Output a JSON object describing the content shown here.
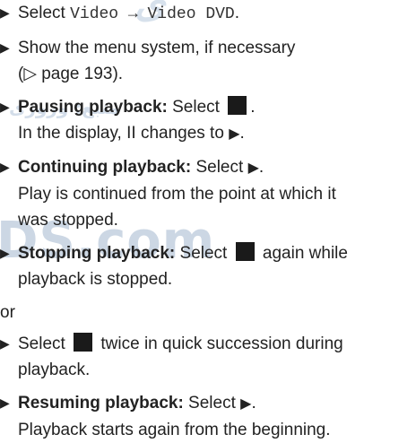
{
  "watermark": {
    "top_text": "ی",
    "rtl_text": "منبع: وروزی",
    "mid_text": "DS.com"
  },
  "steps": [
    {
      "lines": [
        {
          "parts": [
            {
              "t": "text",
              "v": "Select "
            },
            {
              "t": "mono",
              "v": "Video → Video DVD"
            },
            {
              "t": "text",
              "v": "."
            }
          ]
        }
      ]
    },
    {
      "lines": [
        {
          "parts": [
            {
              "t": "text",
              "v": "Show the menu system, if necessary"
            }
          ]
        },
        {
          "parts": [
            {
              "t": "text",
              "v": "(▷ page 193)."
            }
          ]
        }
      ]
    },
    {
      "lines": [
        {
          "parts": [
            {
              "t": "bold",
              "v": "Pausing playback:"
            },
            {
              "t": "text",
              "v": " Select "
            },
            {
              "t": "stop"
            },
            {
              "t": "text",
              "v": "."
            }
          ]
        },
        {
          "parts": [
            {
              "t": "text",
              "v": "In the display, II changes to "
            },
            {
              "t": "play"
            },
            {
              "t": "text",
              "v": "."
            }
          ]
        }
      ]
    },
    {
      "lines": [
        {
          "parts": [
            {
              "t": "bold",
              "v": "Continuing playback:"
            },
            {
              "t": "text",
              "v": " Select "
            },
            {
              "t": "play"
            },
            {
              "t": "text",
              "v": "."
            }
          ]
        },
        {
          "parts": [
            {
              "t": "text",
              "v": "Play is continued from the point at which it"
            }
          ]
        },
        {
          "parts": [
            {
              "t": "text",
              "v": "was stopped."
            }
          ]
        }
      ]
    },
    {
      "lines": [
        {
          "parts": [
            {
              "t": "bold",
              "v": "Stopping playback:"
            },
            {
              "t": "text",
              "v": " Select "
            },
            {
              "t": "stop"
            },
            {
              "t": "text",
              "v": " again while"
            }
          ]
        },
        {
          "parts": [
            {
              "t": "text",
              "v": "playback is stopped."
            }
          ]
        }
      ]
    }
  ],
  "or_text": "or",
  "steps_after": [
    {
      "lines": [
        {
          "parts": [
            {
              "t": "text",
              "v": "Select "
            },
            {
              "t": "stop"
            },
            {
              "t": "text",
              "v": " twice in quick succession during"
            }
          ]
        },
        {
          "parts": [
            {
              "t": "text",
              "v": "playback."
            }
          ]
        }
      ]
    },
    {
      "lines": [
        {
          "parts": [
            {
              "t": "bold",
              "v": "Resuming playback:"
            },
            {
              "t": "text",
              "v": " Select "
            },
            {
              "t": "play"
            },
            {
              "t": "text",
              "v": "."
            }
          ]
        },
        {
          "parts": [
            {
              "t": "text",
              "v": "Playback starts again from the beginning."
            }
          ]
        }
      ]
    }
  ],
  "icons": {
    "bullet": "▶",
    "play": "▶",
    "stop_color": "#1a1a1a"
  }
}
